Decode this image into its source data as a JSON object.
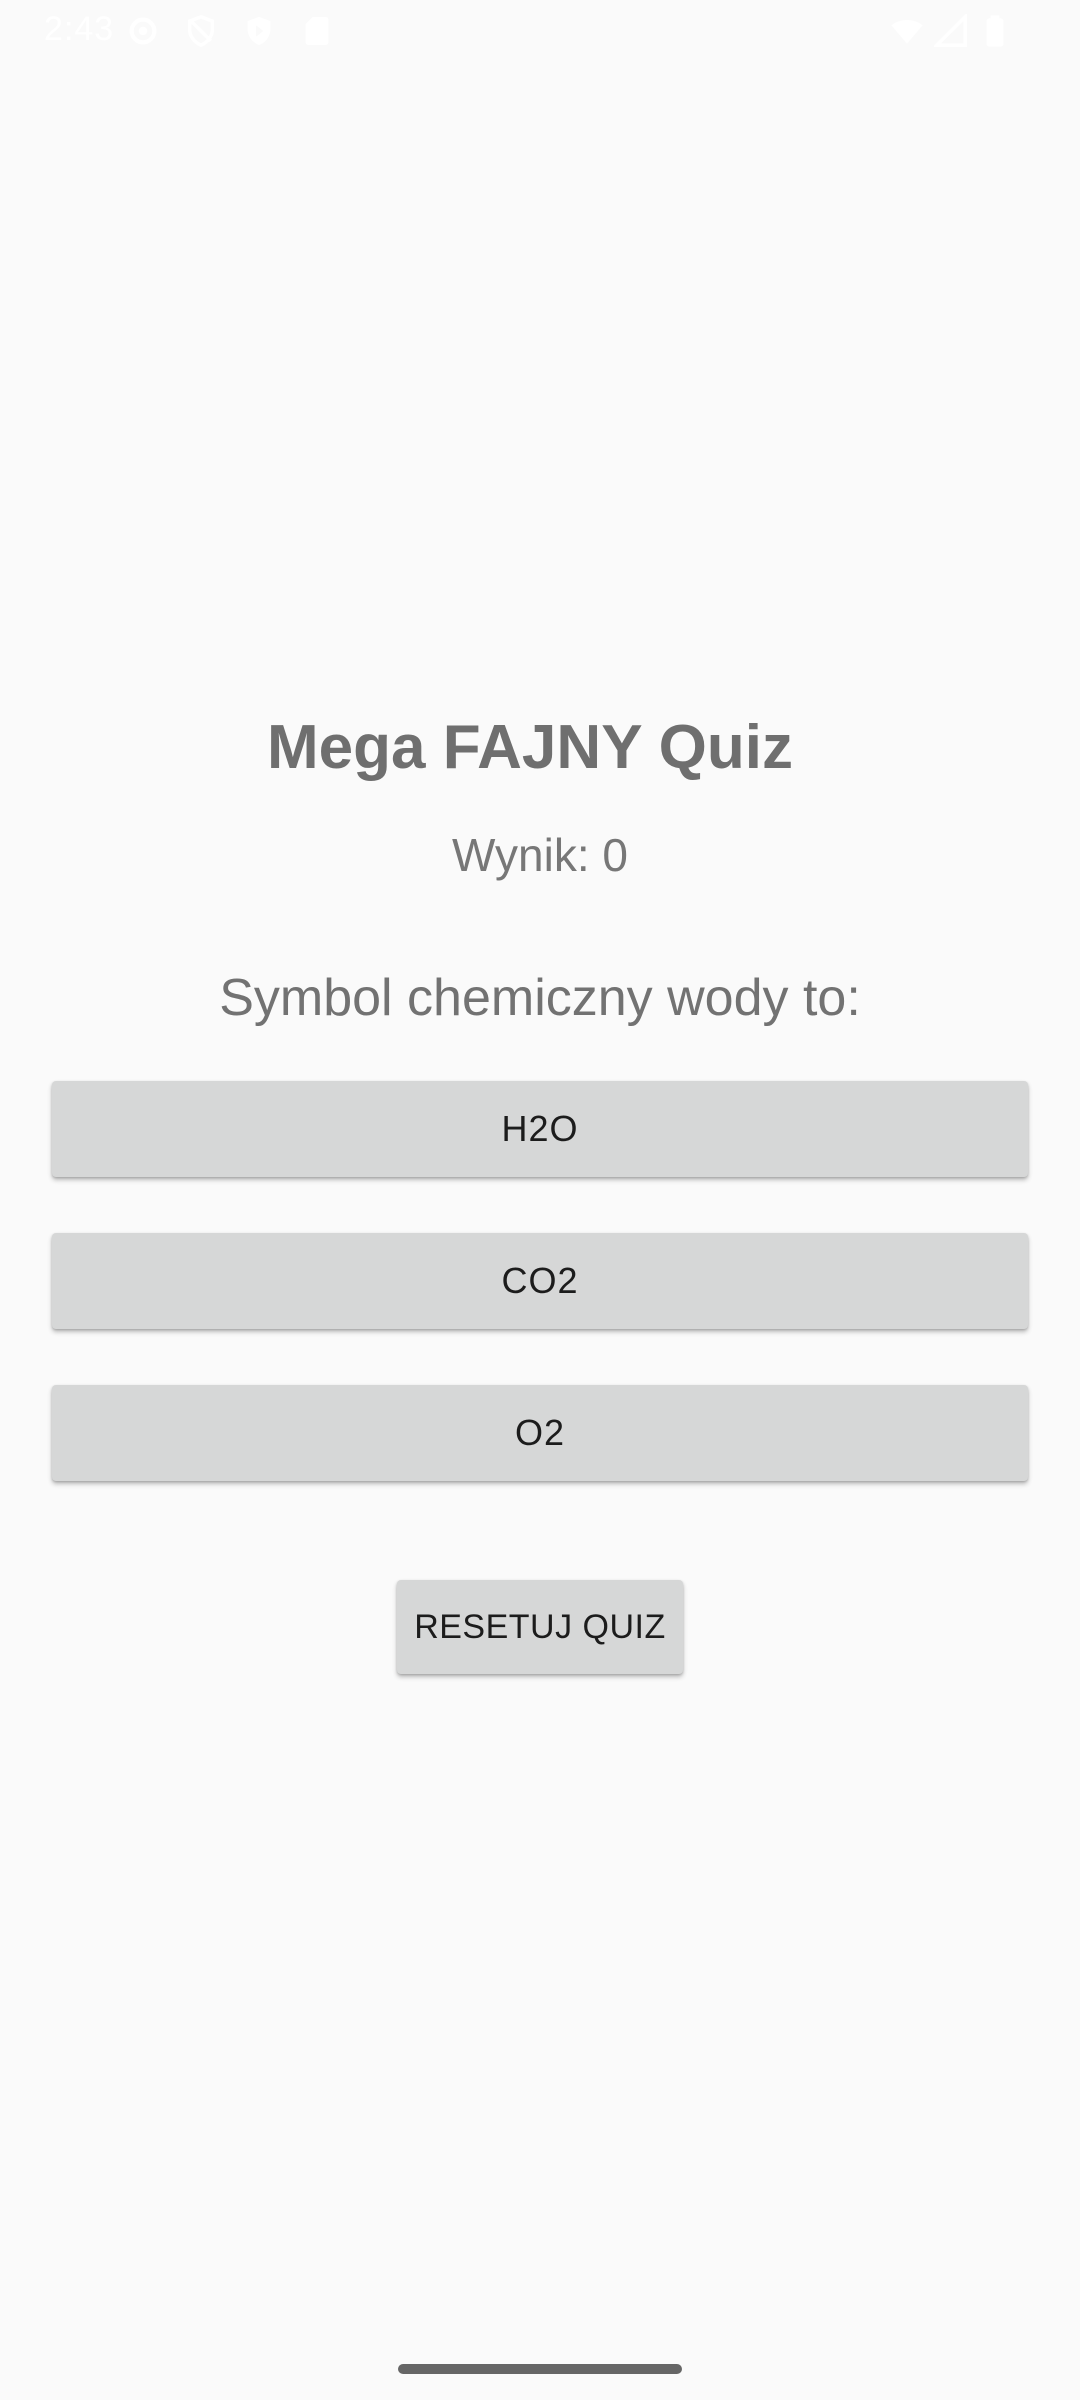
{
  "status_bar": {
    "time": "2:43",
    "icons": [
      "settings-icon",
      "vpn-icon",
      "shield-icon",
      "sd-card-icon",
      "wifi-icon",
      "signal-icon",
      "battery-icon"
    ]
  },
  "quiz": {
    "title": "Mega FAJNY Quiz",
    "score_text": "Wynik: 0",
    "question": "Symbol chemiczny wody to:",
    "answers": [
      {
        "label": "H2O"
      },
      {
        "label": "CO2"
      },
      {
        "label": "O2"
      }
    ],
    "reset_label": "RESETUJ QUIZ"
  },
  "colors": {
    "background": "#fafafa",
    "button_bg": "#d6d7d7",
    "text_muted": "#727272"
  }
}
